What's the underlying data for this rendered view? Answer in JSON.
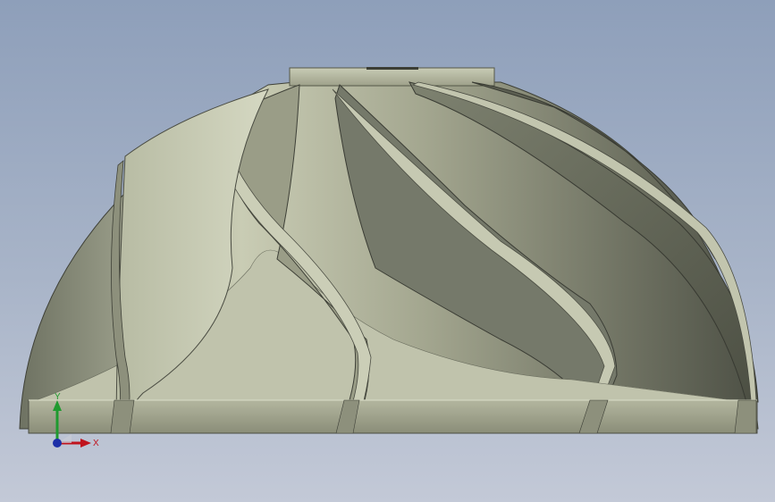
{
  "viewport": {
    "background_top": "#8e9fba",
    "background_bottom": "#c3c9d7",
    "model_color": "#b9bda5",
    "model_shadow_color": "#4f5246"
  },
  "model": {
    "name": "impeller",
    "blade_count": 10
  },
  "triad": {
    "x_label": "X",
    "y_label": "Y",
    "x_color": "#c0141e",
    "y_color": "#1f9a2f",
    "z_color": "#1c2fa8"
  }
}
